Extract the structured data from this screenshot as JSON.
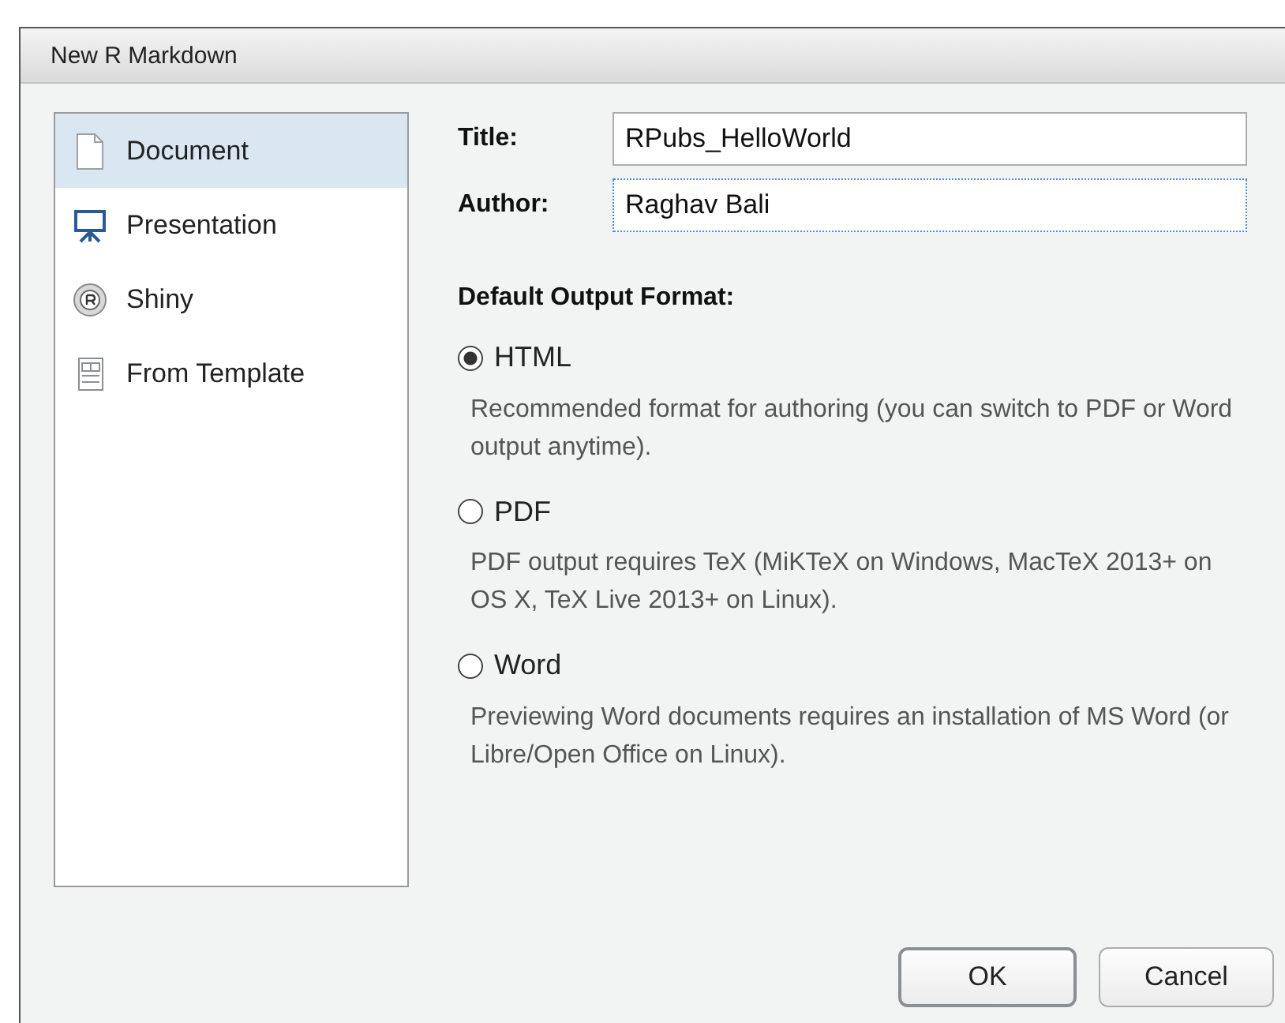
{
  "window": {
    "title": "New R Markdown"
  },
  "sidebar": {
    "items": [
      {
        "label": "Document",
        "kind": "document",
        "selected": true
      },
      {
        "label": "Presentation",
        "kind": "presentation",
        "selected": false
      },
      {
        "label": "Shiny",
        "kind": "shiny",
        "selected": false
      },
      {
        "label": "From Template",
        "kind": "template",
        "selected": false
      }
    ]
  },
  "fields": [
    {
      "label": "Title:",
      "value": "RPubs_HelloWorld",
      "focused": false
    },
    {
      "label": "Author:",
      "value": "Raghav Bali",
      "focused": true
    }
  ],
  "output_format": {
    "heading": "Default Output Format:",
    "options": [
      {
        "label": "HTML",
        "description": "Recommended format for authoring (you can switch to PDF or Word output anytime).",
        "selected": true
      },
      {
        "label": "PDF",
        "description": "PDF output requires TeX (MiKTeX on Windows, MacTeX 2013+ on OS X, TeX Live 2013+ on Linux).",
        "selected": false
      },
      {
        "label": "Word",
        "description": "Previewing Word documents requires an installation of MS Word (or Libre/Open Office on Linux).",
        "selected": false
      }
    ]
  },
  "buttons": [
    {
      "label": "OK",
      "default": true
    },
    {
      "label": "Cancel",
      "default": false
    }
  ]
}
